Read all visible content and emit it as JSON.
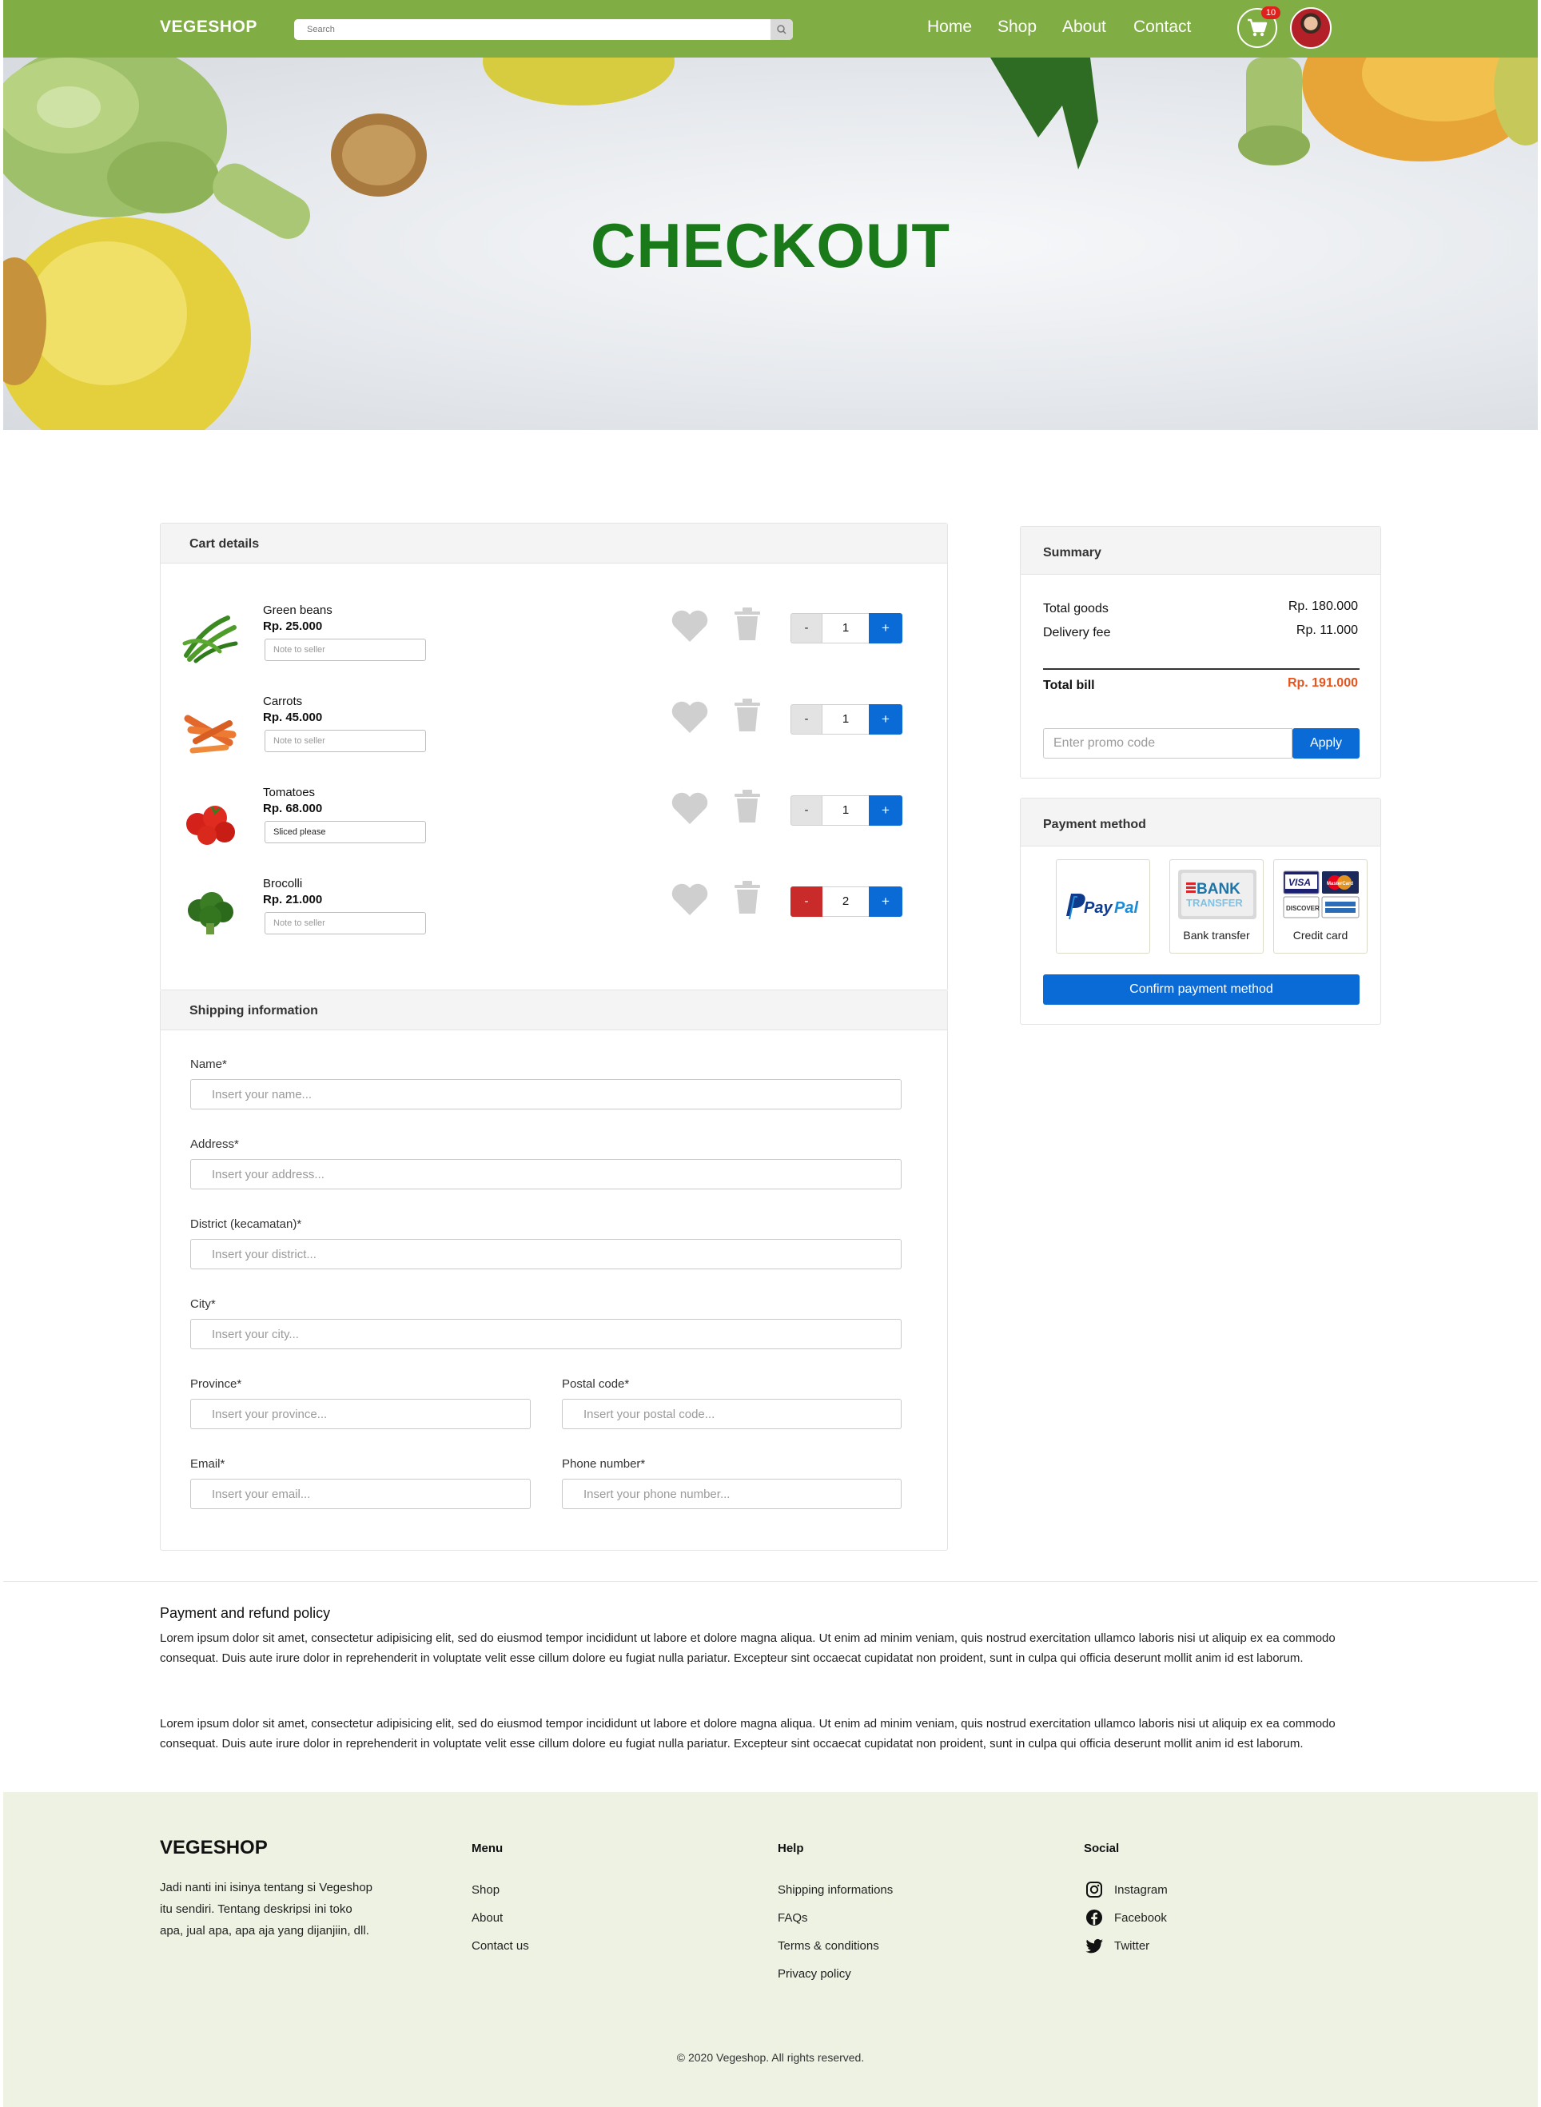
{
  "nav": {
    "brand": "VEGESHOP",
    "search_placeholder": "Search",
    "links": [
      "Home",
      "Shop",
      "About",
      "Contact"
    ],
    "cart_count": "10",
    "brand_color": "#80ad44"
  },
  "hero": {
    "title": "CHECKOUT"
  },
  "cart": {
    "title": "Cart details",
    "items": [
      {
        "name": "Green beans",
        "price": "Rp. 25.000",
        "note_placeholder": "Note to seller",
        "note_value": "",
        "qty": "1",
        "image_icon": "green-beans-image"
      },
      {
        "name": "Carrots",
        "price": "Rp. 45.000",
        "note_placeholder": "Note to seller",
        "note_value": "",
        "qty": "1",
        "image_icon": "carrots-image"
      },
      {
        "name": "Tomatoes",
        "price": "Rp. 68.000",
        "note_placeholder": "Note to seller",
        "note_value": "Sliced please",
        "qty": "1",
        "image_icon": "tomatoes-image"
      },
      {
        "name": "Brocolli",
        "price": "Rp. 21.000",
        "note_placeholder": "Note to seller",
        "note_value": "",
        "qty": "2",
        "image_icon": "broccoli-image"
      }
    ],
    "minus_label": "-",
    "plus_label": "+"
  },
  "shipping": {
    "title": "Shipping information",
    "fields": {
      "name": {
        "label": "Name*",
        "placeholder": "Insert your name..."
      },
      "address": {
        "label": "Address*",
        "placeholder": "Insert your address..."
      },
      "district": {
        "label": "District (kecamatan)*",
        "placeholder": "Insert your district..."
      },
      "city": {
        "label": "City*",
        "placeholder": "Insert your city..."
      },
      "province": {
        "label": "Province*",
        "placeholder": "Insert your province..."
      },
      "postal": {
        "label": "Postal code*",
        "placeholder": "Insert your postal code..."
      },
      "email": {
        "label": "Email*",
        "placeholder": "Insert your email..."
      },
      "phone": {
        "label": "Phone number*",
        "placeholder": "Insert your phone number..."
      }
    }
  },
  "summary": {
    "title": "Summary",
    "total_goods_label": "Total goods",
    "total_goods_value": "Rp. 180.000",
    "delivery_fee_label": "Delivery fee",
    "delivery_fee_value": "Rp. 11.000",
    "total_bill_label": "Total bill",
    "total_bill_value": "Rp. 191.000",
    "total_bill_color": "#e8541b",
    "promo_placeholder": "Enter promo code",
    "apply_label": "Apply"
  },
  "payment": {
    "title": "Payment method",
    "options": {
      "paypal": {
        "logo_pay": "Pay",
        "logo_pal": "Pal"
      },
      "bank": {
        "logo_bank": "BANK",
        "logo_transfer": "TRANSFER",
        "caption": "Bank transfer"
      },
      "card": {
        "caption": "Credit card",
        "visa": "VISA",
        "mastercard": "MasterCard",
        "discover": "DISCOVER"
      }
    },
    "confirm_label": "Confirm payment method",
    "accent_color": "#0a6bd6"
  },
  "policy": {
    "title": "Payment and refund policy",
    "paragraphs": [
      "Lorem ipsum dolor sit amet, consectetur adipisicing elit, sed do eiusmod tempor incididunt ut labore et dolore magna aliqua. Ut enim ad minim veniam, quis nostrud exercitation ullamco laboris nisi ut aliquip ex ea commodo consequat. Duis aute irure dolor in reprehenderit in voluptate velit esse cillum dolore eu fugiat nulla pariatur. Excepteur sint occaecat cupidatat non proident, sunt in culpa qui officia deserunt mollit anim id est laborum.",
      "Lorem ipsum dolor sit amet, consectetur adipisicing elit, sed do eiusmod tempor incididunt ut labore et dolore magna aliqua. Ut enim ad minim veniam, quis nostrud exercitation ullamco laboris nisi ut aliquip ex ea commodo consequat. Duis aute irure dolor in reprehenderit in voluptate velit esse cillum dolore eu fugiat nulla pariatur. Excepteur sint occaecat cupidatat non proident, sunt in culpa qui officia deserunt mollit anim id est laborum."
    ]
  },
  "footer": {
    "brand": "VEGESHOP",
    "description": "Jadi nanti ini isinya tentang si Vegeshop itu sendiri. Tentang deskripsi ini toko apa, jual apa, apa aja yang dijanjiin, dll.",
    "menu": {
      "title": "Menu",
      "links": [
        "Shop",
        "About",
        "Contact us"
      ]
    },
    "help": {
      "title": "Help",
      "links": [
        "Shipping informations",
        "FAQs",
        "Terms & conditions",
        "Privacy policy"
      ]
    },
    "social": {
      "title": "Social",
      "links": [
        "Instagram",
        "Facebook",
        "Twitter"
      ]
    },
    "copyright": "© 2020 Vegeshop. All rights reserved.",
    "background": "#edf2e3"
  }
}
